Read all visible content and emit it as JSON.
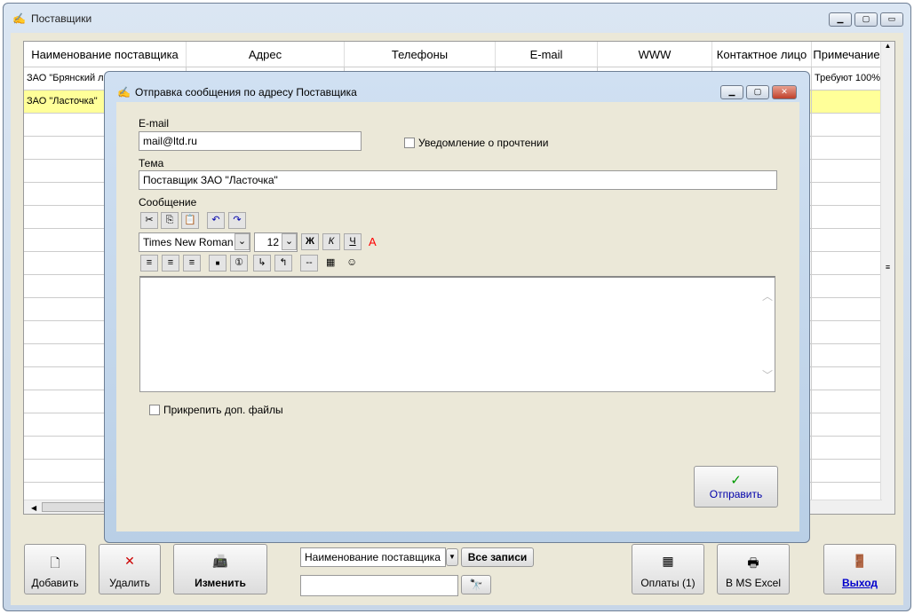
{
  "main_window": {
    "title": "Поставщики",
    "buttons": [
      "minimize",
      "maximize",
      "close"
    ]
  },
  "table": {
    "columns": [
      "Наименование поставщика",
      "Адрес",
      "Телефоны",
      "E-mail",
      "WWW",
      "Контактное лицо",
      "Примечание"
    ],
    "rows": [
      {
        "name": "ЗАО \"Брянский ле",
        "note": "Требуют 100%"
      },
      {
        "name": "ЗАО \"Ласточка\"",
        "note": ""
      }
    ]
  },
  "dialog": {
    "title": "Отправка сообщения по адресу Поставщика",
    "email_label": "E-mail",
    "email_value": "mail@ltd.ru",
    "read_receipt_label": "Уведомление о прочтении",
    "subject_label": "Тема",
    "subject_value": "Поставщик ЗАО \"Ласточка\"",
    "message_label": "Сообщение",
    "font_name": "Times New Roman",
    "font_size": "12",
    "bold": "Ж",
    "italic": "К",
    "underline": "Ч",
    "color": "A",
    "attach_label": "Прикрепить доп. файлы",
    "send_label": "Отправить"
  },
  "bottom": {
    "add": "Добавить",
    "delete": "Удалить",
    "edit": "Изменить",
    "sort_field": "Наименование поставщика",
    "all_records": "Все записи",
    "search_value": "",
    "payments": "Оплаты (1)",
    "excel": "В MS Excel",
    "exit": "Выход"
  },
  "colors": {
    "selected_row": "#ffff99",
    "accent": "#0000cc"
  }
}
